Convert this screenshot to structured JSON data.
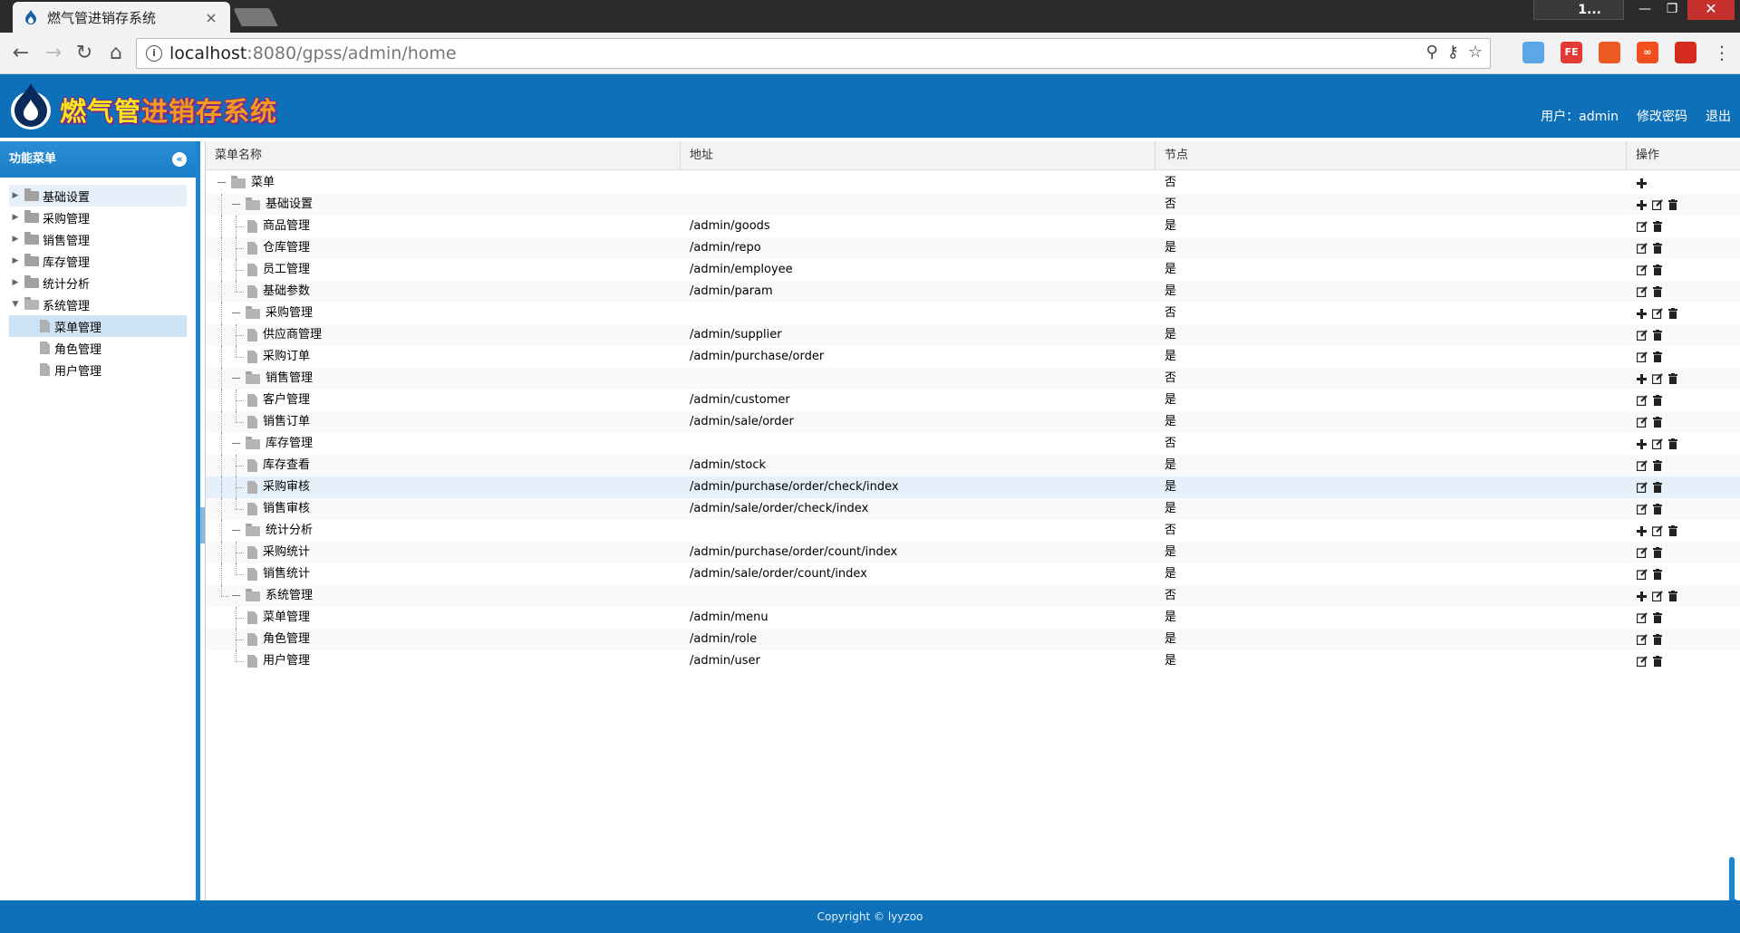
{
  "browser": {
    "tab_title": "燃气管进销存系统",
    "tab_close": "×",
    "profile_label": "1...",
    "window_controls": {
      "minimize": "—",
      "maximize": "❐",
      "close": "✕"
    },
    "url_host": "localhost",
    "url_path": ":8080/gpss/admin/home",
    "nav": {
      "back": "←",
      "forward": "→",
      "reload": "↻",
      "home": "⌂"
    },
    "omnibox_icons": {
      "zoom": "⚲",
      "key": "⚷",
      "star": "☆"
    },
    "extensions": [
      {
        "name": "feather-ext",
        "label": "",
        "color": "#5aa6e6"
      },
      {
        "name": "fe-ext",
        "label": "FE",
        "color": "#e53935"
      },
      {
        "name": "office-ext",
        "label": "",
        "color": "#eb5a1e"
      },
      {
        "name": "infinity-ext",
        "label": "∞",
        "color": "#f0501e"
      },
      {
        "name": "acrobat-ext",
        "label": "",
        "color": "#d62b1f"
      }
    ],
    "menu": "⋮"
  },
  "header": {
    "logo_text_a": "燃气管",
    "logo_text_b": "进销存系统",
    "user_label": "用户：admin",
    "change_password": "修改密码",
    "logout": "退出"
  },
  "sidebar": {
    "title": "功能菜单",
    "collapse": "«",
    "items": [
      {
        "label": "基础设置",
        "type": "folder",
        "expanded": false,
        "level": 0,
        "state": "hover"
      },
      {
        "label": "采购管理",
        "type": "folder",
        "expanded": false,
        "level": 0,
        "state": ""
      },
      {
        "label": "销售管理",
        "type": "folder",
        "expanded": false,
        "level": 0,
        "state": ""
      },
      {
        "label": "库存管理",
        "type": "folder",
        "expanded": false,
        "level": 0,
        "state": ""
      },
      {
        "label": "统计分析",
        "type": "folder",
        "expanded": false,
        "level": 0,
        "state": ""
      },
      {
        "label": "系统管理",
        "type": "folder",
        "expanded": true,
        "level": 0,
        "state": ""
      },
      {
        "label": "菜单管理",
        "type": "file",
        "level": 1,
        "state": "sel"
      },
      {
        "label": "角色管理",
        "type": "file",
        "level": 1,
        "state": ""
      },
      {
        "label": "用户管理",
        "type": "file",
        "level": 1,
        "state": ""
      }
    ]
  },
  "grid": {
    "columns": [
      "菜单名称",
      "地址",
      "节点",
      "操作"
    ],
    "rows": [
      {
        "name": "菜单",
        "url": "",
        "node": "否",
        "type": "root",
        "ops": [
          "add"
        ]
      },
      {
        "name": "基础设置",
        "url": "",
        "node": "否",
        "type": "folder",
        "ops": [
          "add",
          "edit",
          "delete"
        ]
      },
      {
        "name": "商品管理",
        "url": "/admin/goods",
        "node": "是",
        "type": "file",
        "ops": [
          "edit",
          "delete"
        ]
      },
      {
        "name": "仓库管理",
        "url": "/admin/repo",
        "node": "是",
        "type": "file",
        "ops": [
          "edit",
          "delete"
        ]
      },
      {
        "name": "员工管理",
        "url": "/admin/employee",
        "node": "是",
        "type": "file",
        "ops": [
          "edit",
          "delete"
        ]
      },
      {
        "name": "基础参数",
        "url": "/admin/param",
        "node": "是",
        "type": "file-last",
        "ops": [
          "edit",
          "delete"
        ]
      },
      {
        "name": "采购管理",
        "url": "",
        "node": "否",
        "type": "folder",
        "ops": [
          "add",
          "edit",
          "delete"
        ]
      },
      {
        "name": "供应商管理",
        "url": "/admin/supplier",
        "node": "是",
        "type": "file",
        "ops": [
          "edit",
          "delete"
        ]
      },
      {
        "name": "采购订单",
        "url": "/admin/purchase/order",
        "node": "是",
        "type": "file-last",
        "ops": [
          "edit",
          "delete"
        ]
      },
      {
        "name": "销售管理",
        "url": "",
        "node": "否",
        "type": "folder",
        "ops": [
          "add",
          "edit",
          "delete"
        ]
      },
      {
        "name": "客户管理",
        "url": "/admin/customer",
        "node": "是",
        "type": "file",
        "ops": [
          "edit",
          "delete"
        ]
      },
      {
        "name": "销售订单",
        "url": "/admin/sale/order",
        "node": "是",
        "type": "file-last",
        "ops": [
          "edit",
          "delete"
        ]
      },
      {
        "name": "库存管理",
        "url": "",
        "node": "否",
        "type": "folder",
        "ops": [
          "add",
          "edit",
          "delete"
        ]
      },
      {
        "name": "库存查看",
        "url": "/admin/stock",
        "node": "是",
        "type": "file",
        "ops": [
          "edit",
          "delete"
        ]
      },
      {
        "name": "采购审核",
        "url": "/admin/purchase/order/check/index",
        "node": "是",
        "type": "file",
        "ops": [
          "edit",
          "delete"
        ],
        "highlight": true
      },
      {
        "name": "销售审核",
        "url": "/admin/sale/order/check/index",
        "node": "是",
        "type": "file-last",
        "ops": [
          "edit",
          "delete"
        ]
      },
      {
        "name": "统计分析",
        "url": "",
        "node": "否",
        "type": "folder",
        "ops": [
          "add",
          "edit",
          "delete"
        ]
      },
      {
        "name": "采购统计",
        "url": "/admin/purchase/order/count/index",
        "node": "是",
        "type": "file",
        "ops": [
          "edit",
          "delete"
        ]
      },
      {
        "name": "销售统计",
        "url": "/admin/sale/order/count/index",
        "node": "是",
        "type": "file-last",
        "ops": [
          "edit",
          "delete"
        ]
      },
      {
        "name": "系统管理",
        "url": "",
        "node": "否",
        "type": "folder-last",
        "ops": [
          "add",
          "edit",
          "delete"
        ]
      },
      {
        "name": "菜单管理",
        "url": "/admin/menu",
        "node": "是",
        "type": "file-l",
        "ops": [
          "edit",
          "delete"
        ]
      },
      {
        "name": "角色管理",
        "url": "/admin/role",
        "node": "是",
        "type": "file-l",
        "ops": [
          "edit",
          "delete"
        ]
      },
      {
        "name": "用户管理",
        "url": "/admin/user",
        "node": "是",
        "type": "file-l-last",
        "ops": [
          "edit",
          "delete"
        ]
      }
    ]
  },
  "footer": {
    "copyright": "Copyright © lyyzoo"
  },
  "colors": {
    "brand": "#0e70b8",
    "sidebar_accent": "#1b86d0",
    "selection": "#cfe3f6"
  }
}
